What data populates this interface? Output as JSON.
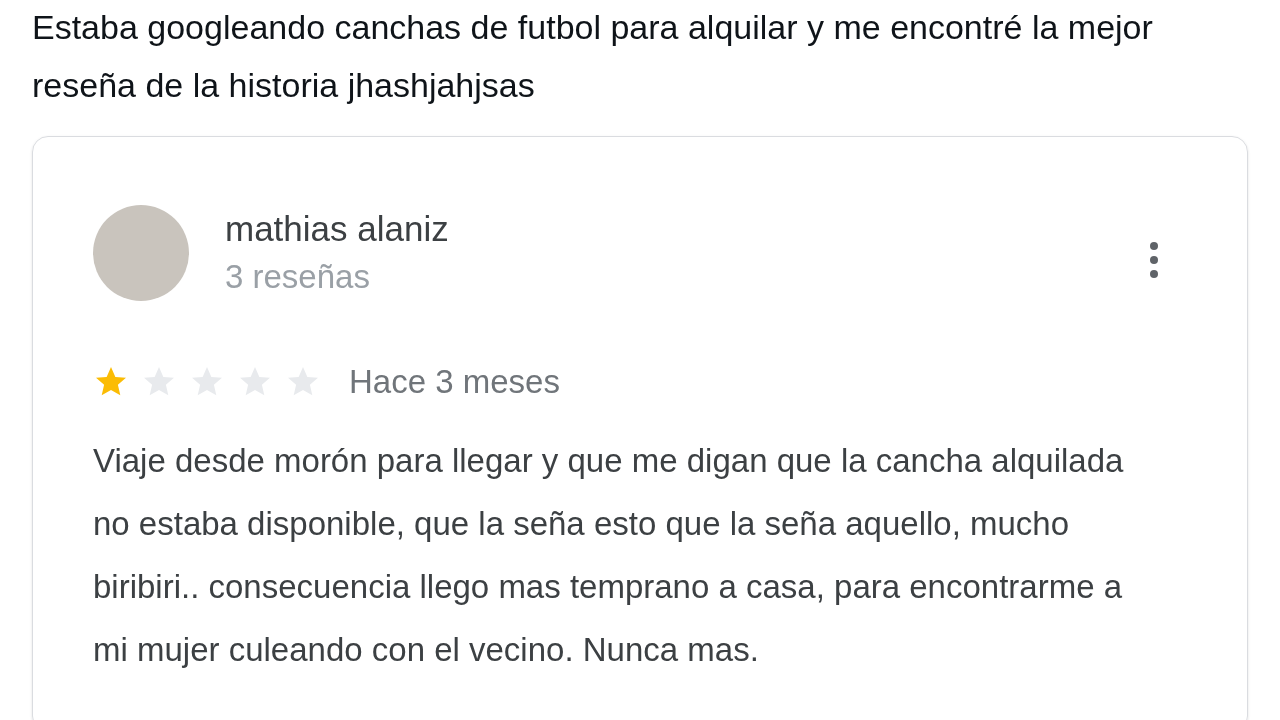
{
  "tweet": {
    "text": "Estaba googleando canchas de futbol para alquilar y me encontré la mejor reseña de la historia jhashjahjsas"
  },
  "review": {
    "author": "mathias alaniz",
    "review_count": "3 reseñas",
    "stars": 1,
    "time": "Hace 3 meses",
    "text": "Viaje desde morón para llegar y que me digan que la cancha alquilada no estaba disponible, que la seña esto que la seña aquello, mucho biribiri.. consecuencia llego mas temprano a casa, para encontrarme a mi mujer culeando con el vecino. Nunca mas."
  }
}
